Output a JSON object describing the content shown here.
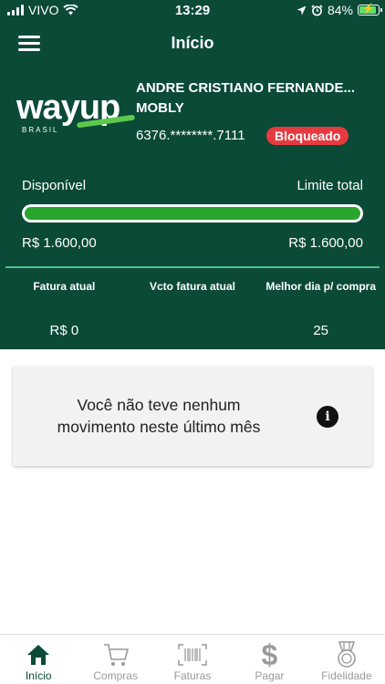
{
  "status_bar": {
    "carrier": "VIVO",
    "time": "13:29",
    "battery": "84%"
  },
  "nav": {
    "title": "Início"
  },
  "card": {
    "logo_text": "wayup",
    "logo_sub": "BRASIL",
    "holder_name": "ANDRE CRISTIANO FERNANDE...",
    "holder_company": "MOBLY",
    "card_number": "6376.********.7111",
    "status_badge": "Bloqueado",
    "status_color": "#e53b40"
  },
  "limits": {
    "available_label": "Disponível",
    "total_label": "Limite total",
    "available_value": "R$ 1.600,00",
    "total_value": "R$ 1.600,00",
    "available_fraction": 1.0
  },
  "summary": [
    {
      "header": "Fatura atual",
      "value": "R$ 0"
    },
    {
      "header": "Vcto fatura atual",
      "value": ""
    },
    {
      "header": "Melhor dia p/ compra",
      "value": "25"
    }
  ],
  "empty_state": {
    "message": "Você não teve nenhum movimento neste último mês",
    "icon": "info-icon"
  },
  "tabs": [
    {
      "label": "Início",
      "icon": "home-icon",
      "active": true
    },
    {
      "label": "Compras",
      "icon": "cart-icon",
      "active": false
    },
    {
      "label": "Faturas",
      "icon": "barcode-icon",
      "active": false
    },
    {
      "label": "Pagar",
      "icon": "dollar-icon",
      "active": false
    },
    {
      "label": "Fidelidade",
      "icon": "medal-icon",
      "active": false
    }
  ],
  "colors": {
    "brand_green": "#0a4a36",
    "bar_green": "#2aa52e",
    "separator": "#4cc18a"
  }
}
